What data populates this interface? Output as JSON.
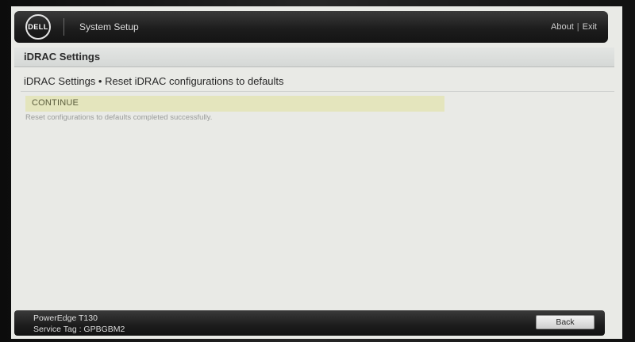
{
  "header": {
    "logo_text": "DELL",
    "app_title": "System Setup",
    "links": {
      "about": "About",
      "separator": "|",
      "exit": "Exit"
    }
  },
  "section": {
    "title": "iDRAC Settings"
  },
  "page": {
    "heading": "iDRAC Settings • Reset iDRAC configurations to defaults",
    "continue_label": "CONTINUE",
    "status_message": "Reset configurations to defaults completed successfully."
  },
  "footer": {
    "model": "PowerEdge T130",
    "service_tag": "Service Tag : GPBGBM2",
    "back_label": "Back"
  },
  "colors": {
    "header_bg": "#1d1d1d",
    "screen_bg": "#e9eae6",
    "continue_highlight": "#e4e5bd"
  }
}
